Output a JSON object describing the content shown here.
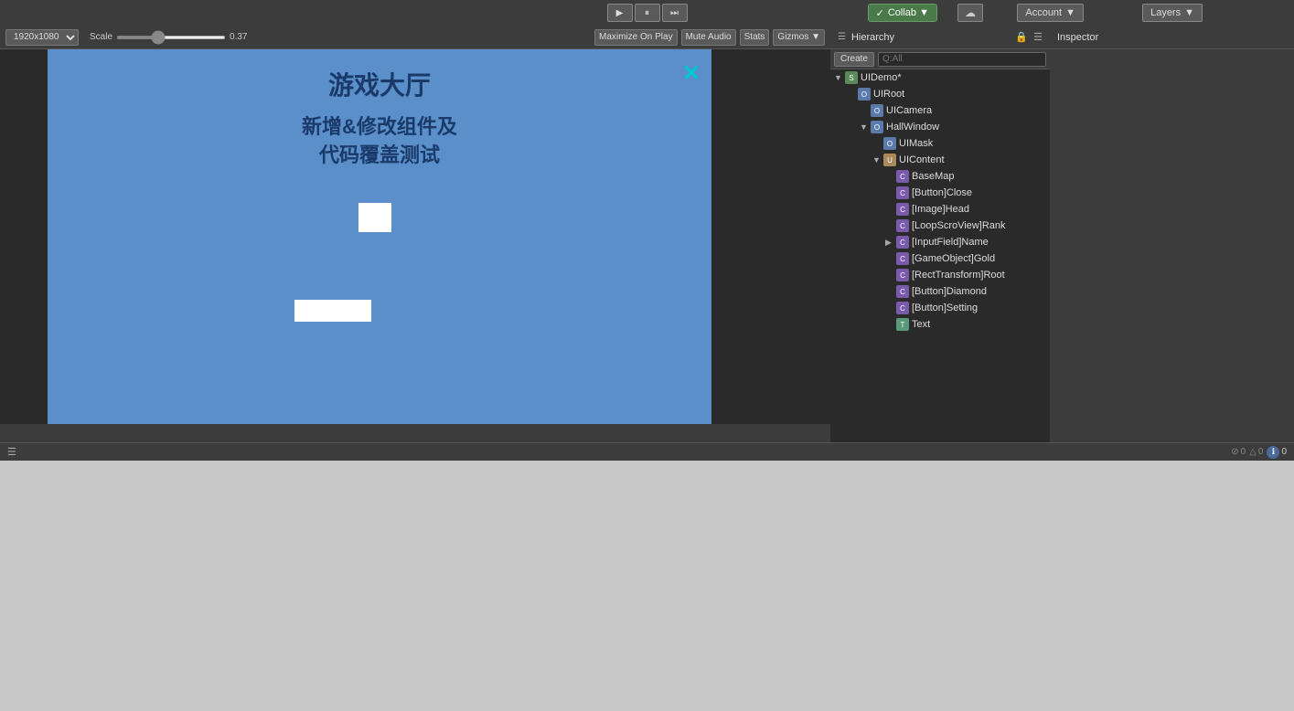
{
  "toolbar": {
    "play_label": "▶",
    "pause_label": "⏸",
    "step_label": "⏭",
    "collab_label": "Collab ▼",
    "cloud_label": "☁",
    "account_label": "Account",
    "account_arrow": "▼",
    "layers_label": "Layers",
    "layers_arrow": "▼"
  },
  "scene_toolbar": {
    "resolution": "1920x1080",
    "scale_label": "Scale",
    "scale_value": "0.37",
    "maximize_label": "Maximize On Play",
    "mute_label": "Mute Audio",
    "stats_label": "Stats",
    "gizmos_label": "Gizmos ▼"
  },
  "hierarchy": {
    "panel_title": "Hierarchy",
    "create_label": "Create",
    "search_placeholder": "Q:All",
    "items": [
      {
        "id": "uidemo",
        "label": "UIDemo*",
        "indent": 0,
        "arrow": "▼",
        "icon": "scene",
        "selected": false
      },
      {
        "id": "uiroot",
        "label": "UIRoot",
        "indent": 1,
        "arrow": "",
        "icon": "object",
        "selected": false
      },
      {
        "id": "uicamera",
        "label": "UICamera",
        "indent": 2,
        "arrow": "",
        "icon": "object",
        "selected": false
      },
      {
        "id": "hallwindow",
        "label": "HallWindow",
        "indent": 2,
        "arrow": "▼",
        "icon": "object",
        "selected": false
      },
      {
        "id": "uimask",
        "label": "UIMask",
        "indent": 3,
        "arrow": "",
        "icon": "object",
        "selected": false
      },
      {
        "id": "uicontent",
        "label": "UIContent",
        "indent": 3,
        "arrow": "▼",
        "icon": "ui",
        "selected": false
      },
      {
        "id": "basemap",
        "label": "BaseMap",
        "indent": 4,
        "arrow": "",
        "icon": "component",
        "selected": false
      },
      {
        "id": "buttonclose",
        "label": "[Button]Close",
        "indent": 4,
        "arrow": "",
        "icon": "component",
        "selected": false
      },
      {
        "id": "imagehead",
        "label": "[Image]Head",
        "indent": 4,
        "arrow": "",
        "icon": "component",
        "selected": false
      },
      {
        "id": "loopscroviewrank",
        "label": "[LoopScroView]Rank",
        "indent": 4,
        "arrow": "",
        "icon": "component",
        "selected": false
      },
      {
        "id": "inputfieldname",
        "label": "[InputField]Name",
        "indent": 4,
        "arrow": "▶",
        "icon": "component",
        "selected": false
      },
      {
        "id": "gameobjectgold",
        "label": "[GameObject]Gold",
        "indent": 4,
        "arrow": "",
        "icon": "component",
        "selected": false
      },
      {
        "id": "recttransformroot",
        "label": "[RectTransform]Root",
        "indent": 4,
        "arrow": "",
        "icon": "component",
        "selected": false
      },
      {
        "id": "buttondiamond",
        "label": "[Button]Diamond",
        "indent": 4,
        "arrow": "",
        "icon": "component",
        "selected": false
      },
      {
        "id": "buttonsetting",
        "label": "[Button]Setting",
        "indent": 4,
        "arrow": "",
        "icon": "component",
        "selected": false
      },
      {
        "id": "text",
        "label": "Text",
        "indent": 4,
        "arrow": "",
        "icon": "text",
        "selected": false
      }
    ]
  },
  "inspector": {
    "panel_title": "Inspector"
  },
  "game": {
    "title": "游戏大厅",
    "subtitle_line1": "新增&修改组件及",
    "subtitle_line2": "代码覆盖测试",
    "close_symbol": "✕"
  },
  "status": {
    "error_count": "0",
    "warning_count": "0",
    "info_count": "0"
  }
}
